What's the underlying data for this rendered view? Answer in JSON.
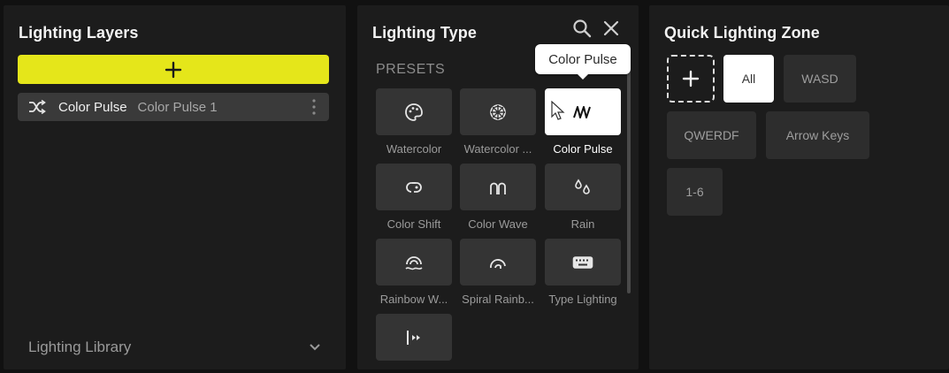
{
  "layers_panel": {
    "title": "Lighting Layers",
    "add_button_icon": "plus-icon",
    "layers": [
      {
        "icon": "shuffle-icon",
        "name": "Color Pulse",
        "instance": "Color Pulse 1"
      }
    ],
    "library_label": "Lighting Library"
  },
  "type_panel": {
    "title": "Lighting Type",
    "section_label": "PRESETS",
    "tooltip": "Color Pulse",
    "presets": [
      {
        "label": "Watercolor",
        "icon": "palette-icon"
      },
      {
        "label": "Watercolor ...",
        "icon": "wheel-icon"
      },
      {
        "label": "Color Pulse",
        "icon": "pulse-wave-icon",
        "selected": true
      },
      {
        "label": "Color Shift",
        "icon": "shift-icon"
      },
      {
        "label": "Color Wave",
        "icon": "wave-icon"
      },
      {
        "label": "Rain",
        "icon": "rain-drops-icon"
      },
      {
        "label": "Rainbow W...",
        "icon": "rainbow-wave-icon"
      },
      {
        "label": "Spiral Rainb...",
        "icon": "spiral-icon"
      },
      {
        "label": "Type Lighting",
        "icon": "keyboard-icon"
      },
      {
        "label": "",
        "icon": "visualizer-icon"
      }
    ]
  },
  "zone_panel": {
    "title": "Quick Lighting Zone",
    "zones": [
      {
        "label": "All",
        "active": true
      },
      {
        "label": "WASD"
      },
      {
        "label": "QWERDF"
      },
      {
        "label": "Arrow Keys"
      },
      {
        "label": "1-6"
      }
    ]
  },
  "colors": {
    "accent_yellow": "#e5e61a",
    "panel_bg": "#1c1c1c",
    "tile_bg": "#343434",
    "selected_bg": "#ffffff"
  }
}
